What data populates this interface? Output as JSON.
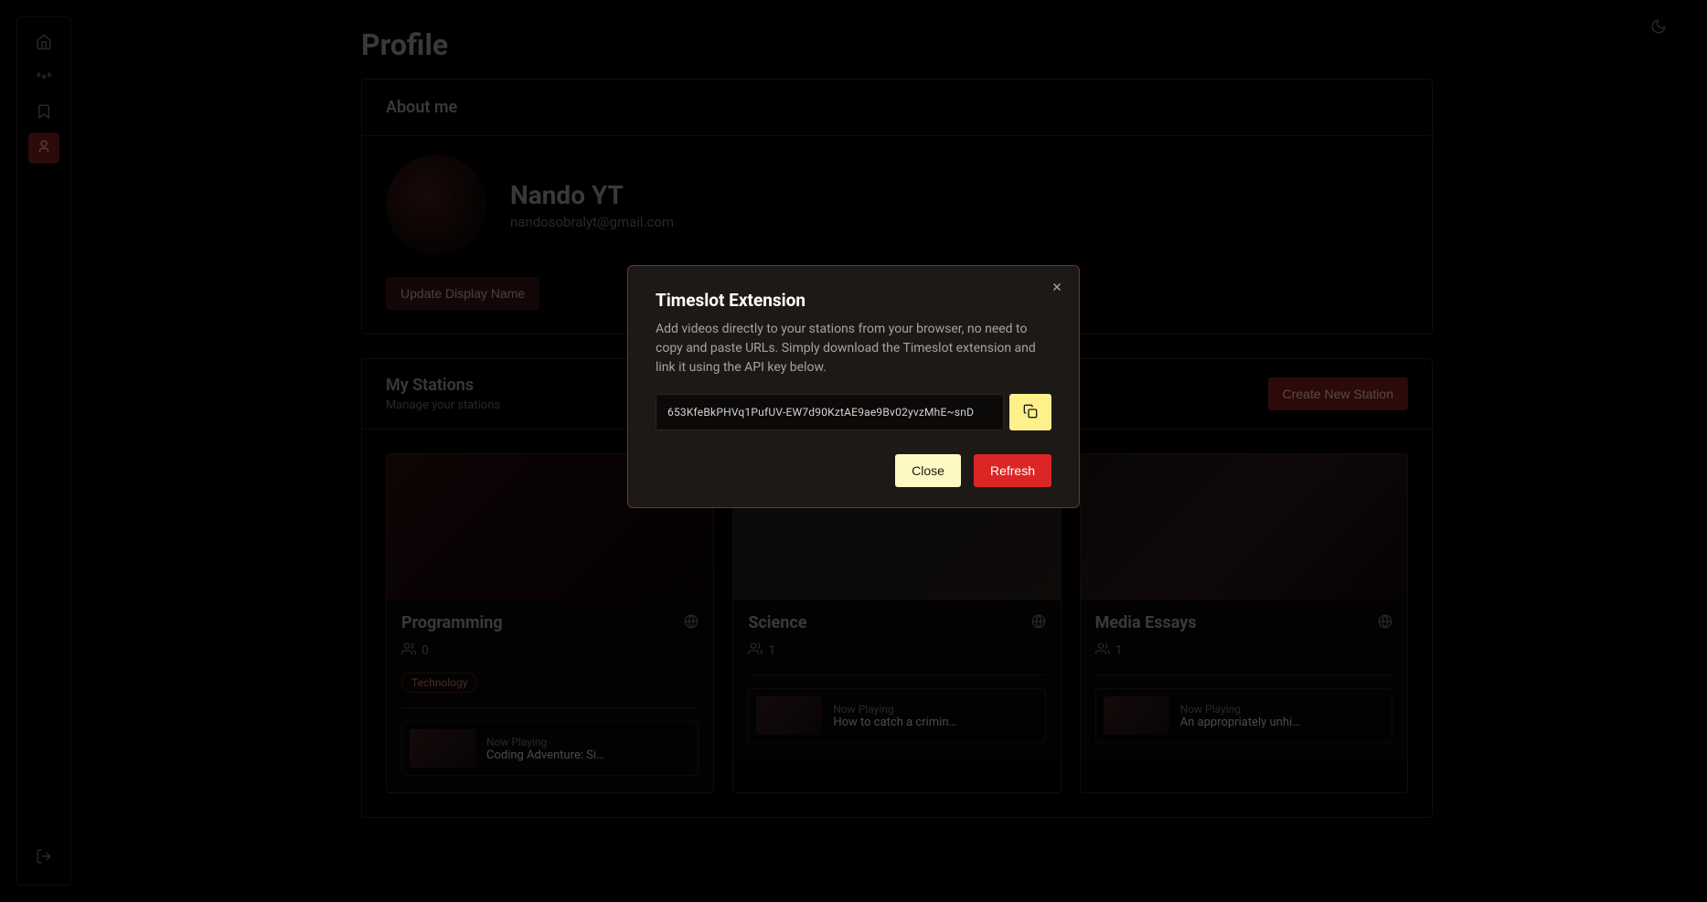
{
  "page": {
    "title": "Profile"
  },
  "about": {
    "section_title": "About me",
    "display_name": "Nando YT",
    "email": "nandosobralyt@gmail.com",
    "update_button": "Update Display Name"
  },
  "stations_section": {
    "title": "My Stations",
    "subtitle": "Manage your stations",
    "create_button": "Create New Station"
  },
  "stations": [
    {
      "title": "Programming",
      "viewers": "0",
      "tag": "Technology",
      "np_label": "Now Playing",
      "np_title": "Coding Adventure: Si…"
    },
    {
      "title": "Science",
      "viewers": "1",
      "tag": "",
      "np_label": "Now Playing",
      "np_title": "How to catch a crimin…"
    },
    {
      "title": "Media Essays",
      "viewers": "1",
      "tag": "",
      "np_label": "Now Playing",
      "np_title": "An appropriately unhi…"
    }
  ],
  "modal": {
    "title": "Timeslot Extension",
    "description": "Add videos directly to your stations from your browser, no need to copy and paste URLs. Simply download the Timeslot extension and link it using the API key below.",
    "api_key": "653KfeBkPHVq1PufUV-EW7d90KztAE9ae9Bv02yvzMhE~snD",
    "close": "Close",
    "refresh": "Refresh"
  }
}
